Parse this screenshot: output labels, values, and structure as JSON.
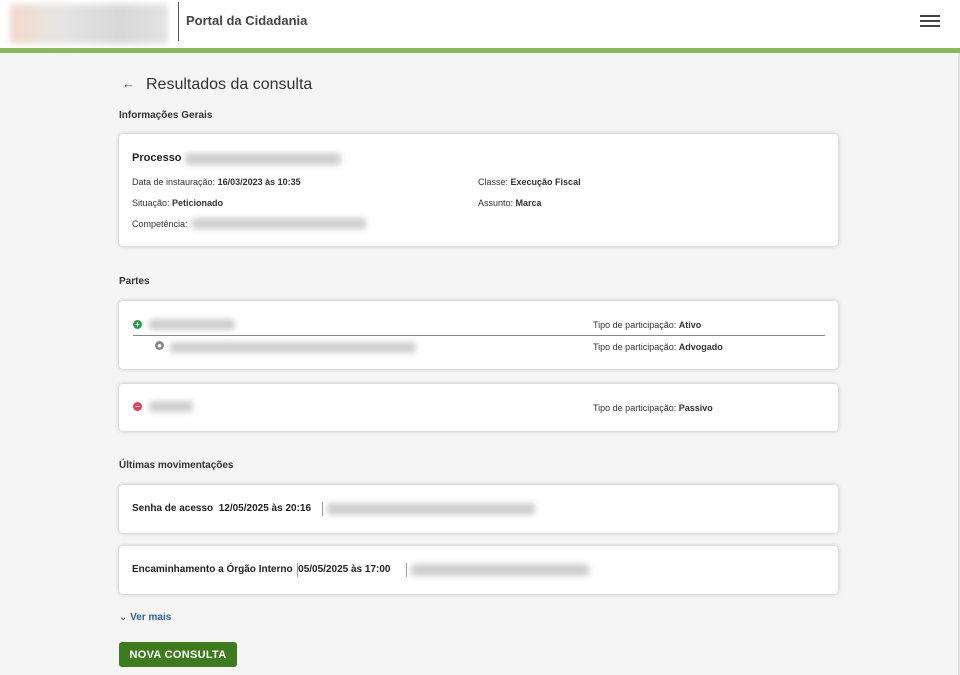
{
  "header": {
    "portal_title": "Portal da Cidadania",
    "menu_icon": "hamburger-menu-icon"
  },
  "page": {
    "title": "Resultados da consulta",
    "back_icon": "arrow-left-icon"
  },
  "info": {
    "section_title": "Informações Gerais",
    "processo_label": "Processo",
    "data_label": "Data de instauração:",
    "data_value": "16/03/2023 às 10:35",
    "situacao_label": "Situação:",
    "situacao_value": "Peticionado",
    "competencia_label": "Competência:",
    "classe_label": "Classe:",
    "classe_value": "Execução Fiscal",
    "assunto_label": "Assunto:",
    "assunto_value": "Marca"
  },
  "partes": {
    "section_title": "Partes",
    "tipo_label": "Tipo de participação:",
    "ativo": "Ativo",
    "advogado": "Advogado",
    "passivo": "Passivo",
    "plus_symbol": "+",
    "minus_symbol": "−"
  },
  "movimentacoes": {
    "section_title": "Últimas movimentações",
    "items": [
      {
        "title": "Senha de acesso",
        "datetime": "12/05/2025 às 20:16"
      },
      {
        "title": "Encaminhamento a Órgão Interno",
        "datetime": "05/05/2025 às 17:00"
      }
    ],
    "ver_mais": "Ver mais"
  },
  "actions": {
    "nova_consulta": "NOVA CONSULTA"
  },
  "colors": {
    "accent_green": "#8cb85c",
    "button_green": "#3f7a1f",
    "ativo_green": "#2e9c4a",
    "passivo_red": "#e0405a",
    "link_blue": "#2a6496"
  }
}
